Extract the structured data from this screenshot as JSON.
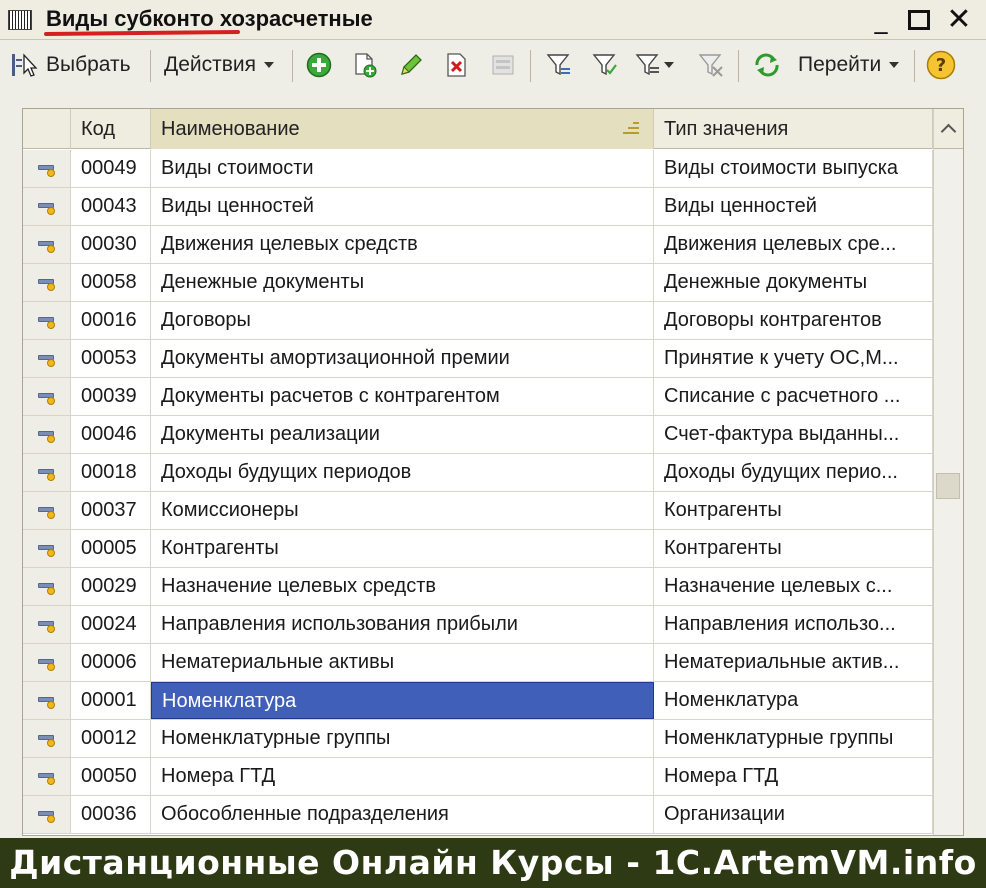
{
  "window": {
    "title": "Виды субконто хозрасчетные",
    "minimize": "_",
    "close": "✕"
  },
  "toolbar": {
    "select_label": "Выбрать",
    "actions_label": "Действия",
    "goto_label": "Перейти",
    "icons": [
      "select-cursor-icon",
      "add-icon",
      "copy-add-icon",
      "edit-pencil-icon",
      "delete-icon",
      "post-icon",
      "filter-icon",
      "filter-by-value-icon",
      "filter-list-icon",
      "clear-filter-icon",
      "refresh-icon",
      "help-icon"
    ]
  },
  "grid": {
    "columns": {
      "code": "Код",
      "name": "Наименование",
      "type": "Тип значения"
    },
    "sorted_column": "name",
    "rows": [
      {
        "code": "00049",
        "name": "Виды стоимости",
        "type": "Виды стоимости выпуска"
      },
      {
        "code": "00043",
        "name": "Виды ценностей",
        "type": "Виды ценностей"
      },
      {
        "code": "00030",
        "name": "Движения целевых средств",
        "type": "Движения целевых сре..."
      },
      {
        "code": "00058",
        "name": "Денежные документы",
        "type": "Денежные документы"
      },
      {
        "code": "00016",
        "name": "Договоры",
        "type": "Договоры контрагентов"
      },
      {
        "code": "00053",
        "name": "Документы амортизационной премии",
        "type": "Принятие к учету ОС,М..."
      },
      {
        "code": "00039",
        "name": "Документы расчетов с контрагентом",
        "type": "Списание с расчетного ..."
      },
      {
        "code": "00046",
        "name": "Документы реализации",
        "type": "Счет-фактура выданны..."
      },
      {
        "code": "00018",
        "name": "Доходы будущих периодов",
        "type": "Доходы будущих перио..."
      },
      {
        "code": "00037",
        "name": "Комиссионеры",
        "type": "Контрагенты"
      },
      {
        "code": "00005",
        "name": "Контрагенты",
        "type": "Контрагенты"
      },
      {
        "code": "00029",
        "name": "Назначение целевых средств",
        "type": "Назначение целевых с..."
      },
      {
        "code": "00024",
        "name": "Направления использования прибыли",
        "type": "Направления использо..."
      },
      {
        "code": "00006",
        "name": "Нематериальные активы",
        "type": "Нематериальные актив..."
      },
      {
        "code": "00001",
        "name": "Номенклатура",
        "type": "Номенклатура"
      },
      {
        "code": "00012",
        "name": "Номенклатурные группы",
        "type": "Номенклатурные группы"
      },
      {
        "code": "00050",
        "name": "Номера ГТД",
        "type": "Номера ГТД"
      },
      {
        "code": "00036",
        "name": "Обособленные подразделения",
        "type": "Организации"
      }
    ],
    "selected_row_index": 14
  },
  "banner": {
    "text": "Дистанционные Онлайн Курсы - 1C.ArtemVM.info"
  },
  "colors": {
    "selection": "#3f5fb8",
    "title_underline": "#d62020",
    "banner_bg": "#2e3a13"
  }
}
